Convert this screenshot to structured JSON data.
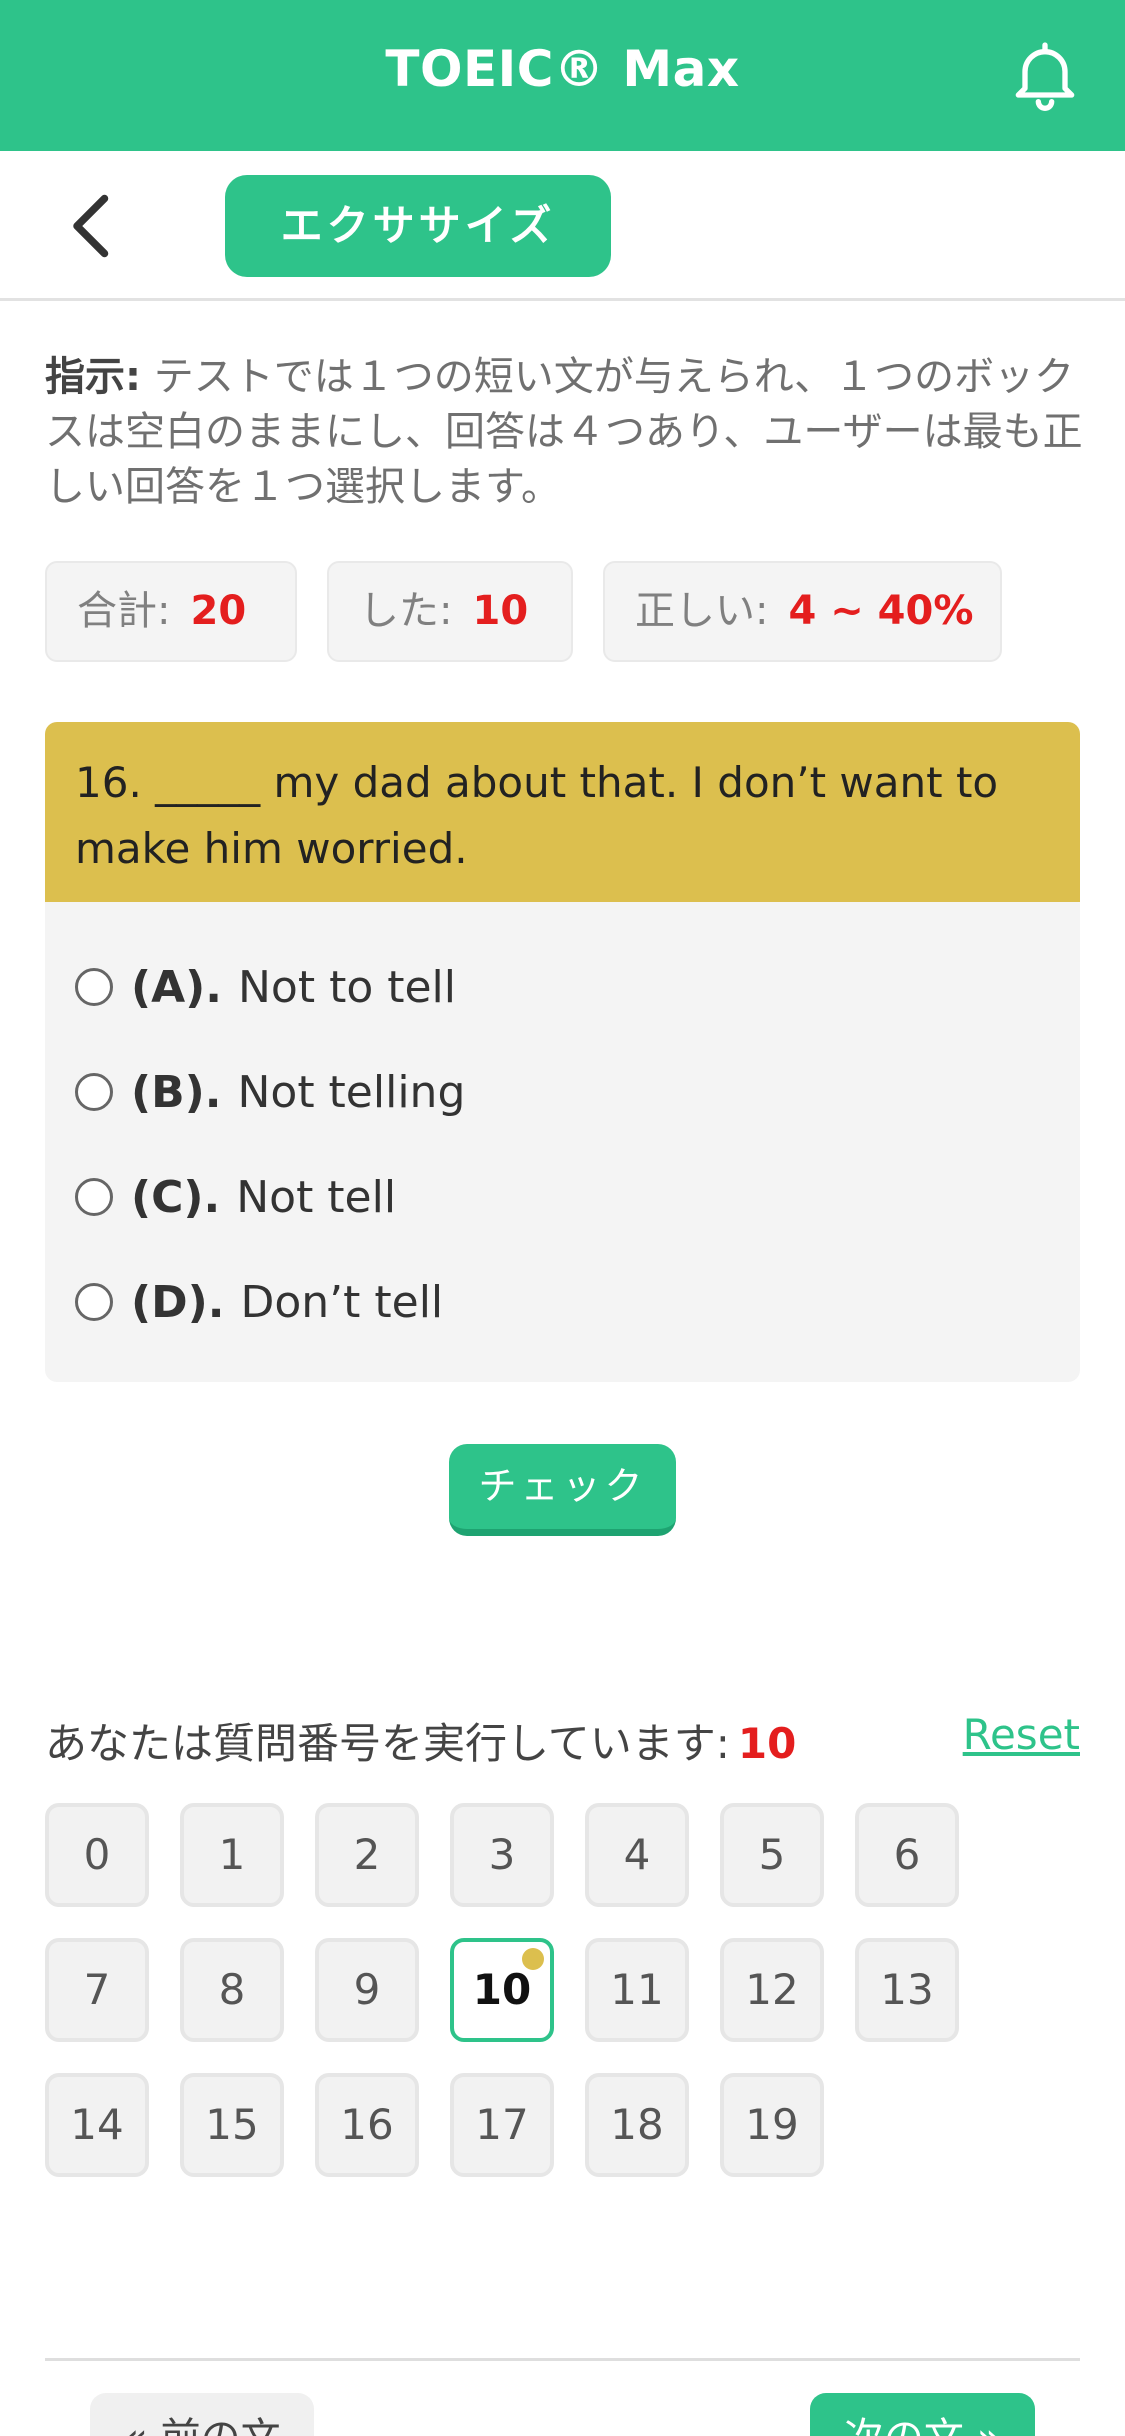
{
  "app": {
    "title": "TOEIC® Max"
  },
  "nav": {
    "active_tab": "エクササイズ"
  },
  "instructions": {
    "label": "指示:",
    "text": " テストでは１つの短い文が与えられ、１つのボックスは空白のままにし、回答は４つあり、ユーザーは最も正しい回答を１つ選択します。"
  },
  "stats": [
    {
      "label": "合計:",
      "value": "20"
    },
    {
      "label": "した:",
      "value": "10"
    },
    {
      "label": "正しい:",
      "value": "4 ~ 40%"
    }
  ],
  "question": {
    "text": "16. _____ my dad about that. I don’t want to make him worried.",
    "options": [
      {
        "letter": "(A).",
        "text": "Not to tell"
      },
      {
        "letter": "(B).",
        "text": "Not telling"
      },
      {
        "letter": "(C).",
        "text": "Not tell"
      },
      {
        "letter": "(D).",
        "text": "Don’t tell"
      }
    ]
  },
  "check_label": "チェック",
  "progress": {
    "label": "あなたは質問番号を実行しています:",
    "current": "10",
    "reset": "Reset"
  },
  "question_numbers": [
    "0",
    "1",
    "2",
    "3",
    "4",
    "5",
    "6",
    "7",
    "8",
    "9",
    "10",
    "11",
    "12",
    "13",
    "14",
    "15",
    "16",
    "17",
    "18",
    "19"
  ],
  "active_question": "10",
  "footer": {
    "prev": "« 前の文",
    "next": "次の文 »"
  },
  "colors": {
    "primary": "#2ec38a",
    "question_header": "#dcbf4e",
    "accent_red": "#e41e1e"
  }
}
